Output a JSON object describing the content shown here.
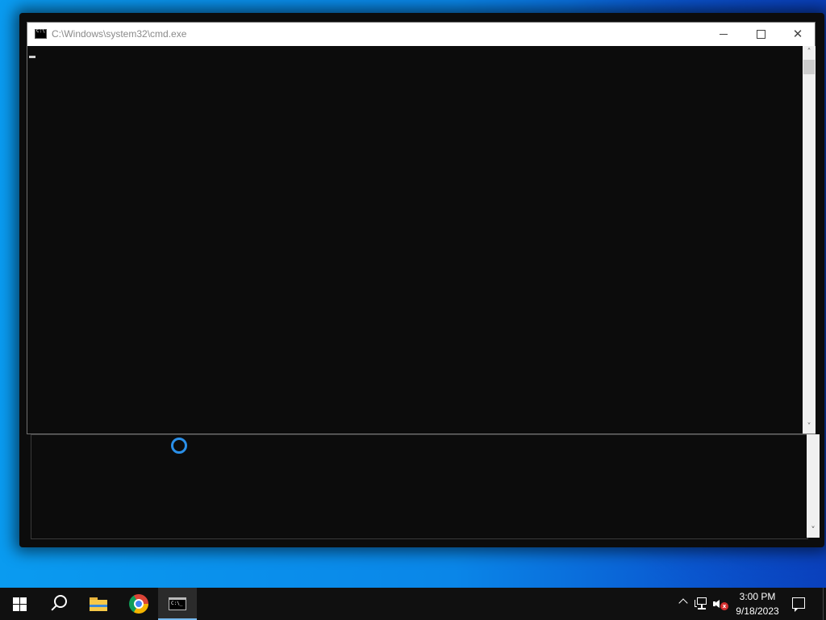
{
  "window": {
    "title": "C:\\Windows\\system32\\cmd.exe",
    "console_text": ""
  },
  "scrollbar": {
    "up_arrow": "˄",
    "down_arrow": "˅"
  },
  "caption_buttons": {
    "close_glyph": "✕"
  },
  "taskbar": {
    "pinned": [
      "start",
      "search",
      "file-explorer",
      "google-chrome",
      "command-prompt"
    ],
    "active_app": "command-prompt"
  },
  "tray": {
    "time": "3:00 PM",
    "date": "9/18/2023",
    "volume_state": "muted",
    "mute_badge": "x"
  },
  "colors": {
    "console_bg": "#0c0c0c",
    "taskbar_bg": "#101010",
    "desktop_blue": "#0a86e8",
    "busy_ring": "#2a8fe8"
  },
  "icons": [
    "cmd-icon",
    "minimize-icon",
    "maximize-icon",
    "close-icon",
    "windows-logo-icon",
    "search-icon",
    "folder-icon",
    "chrome-icon",
    "terminal-icon",
    "chevron-up-icon",
    "network-icon",
    "volume-muted-icon",
    "notification-icon",
    "busy-cursor-icon"
  ]
}
